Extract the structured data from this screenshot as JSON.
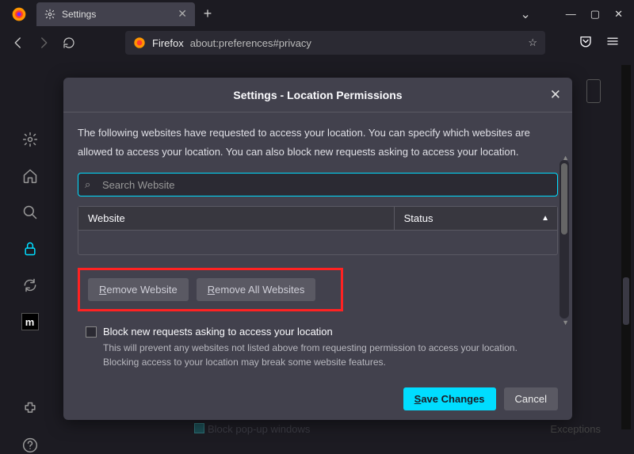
{
  "titlebar": {
    "tab_label": "Settings"
  },
  "urlbar": {
    "browser_label": "Firefox",
    "url": "about:preferences#privacy"
  },
  "leftrail": {
    "m_label": "m"
  },
  "dialog": {
    "title": "Settings - Location Permissions",
    "intro": "The following websites have requested to access your location. You can specify which websites are allowed to access your location. You can also block new requests asking to access your location.",
    "search_placeholder": "Search Website",
    "table": {
      "col_website": "Website",
      "col_status": "Status"
    },
    "remove_website_prefix": "R",
    "remove_website_rest": "emove Website",
    "remove_all_prefix": "R",
    "remove_all_rest": "emove All Websites",
    "block_checkbox": "Block new requests asking to access your location",
    "block_helper": "This will prevent any websites not listed above from requesting permission to access your location. Blocking access to your location may break some website features.",
    "save_prefix": "S",
    "save_rest": "ave Changes",
    "cancel": "Cancel"
  },
  "background": {
    "exceptions": "Exceptions",
    "popup": "Block pop-up windows"
  }
}
